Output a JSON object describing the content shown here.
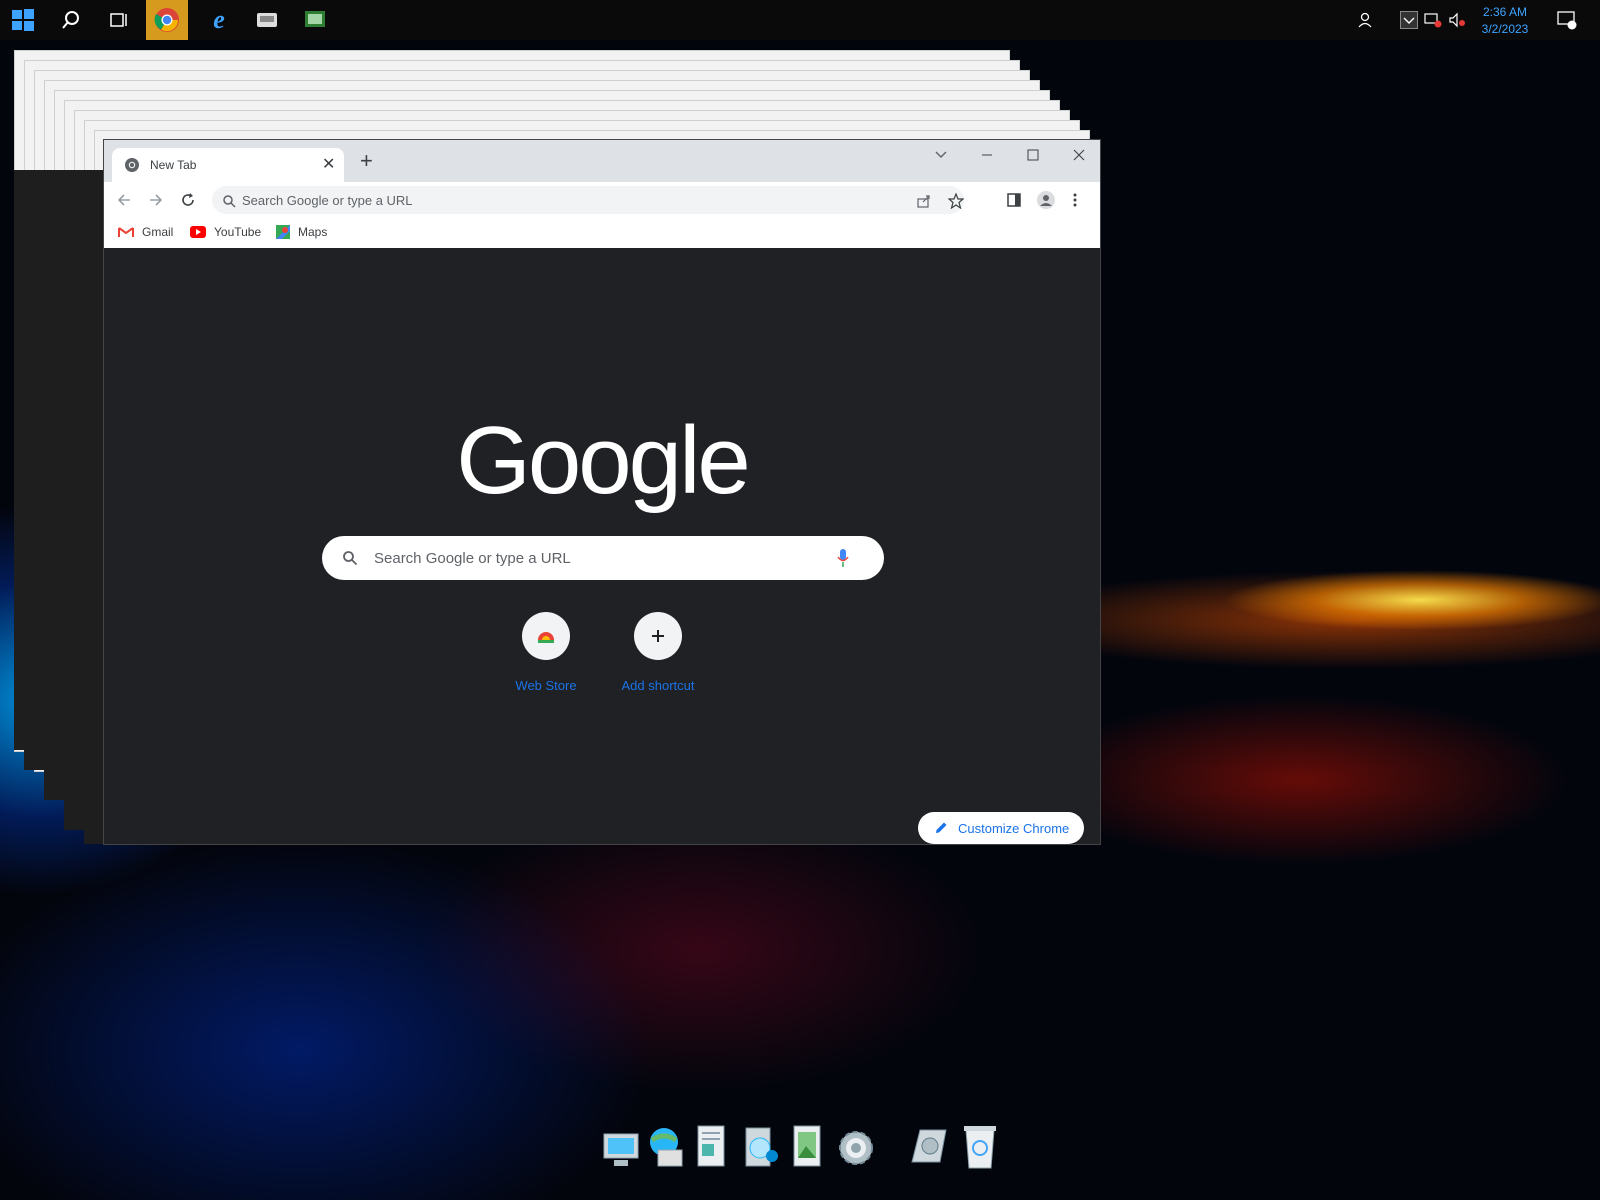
{
  "taskbar": {
    "items": [
      "start-icon",
      "search-icon",
      "task-view-icon",
      "chrome-icon",
      "internet-explorer-icon",
      "app-icon",
      "app-icon-2"
    ],
    "clock": {
      "time": "2:36 AM",
      "date": "3/2/2023"
    }
  },
  "browser": {
    "tab": {
      "title": "New Tab"
    },
    "omnibox": {
      "placeholder": "Search Google or type a URL"
    },
    "bookmarks": [
      {
        "label": "Gmail"
      },
      {
        "label": "YouTube"
      },
      {
        "label": "Maps"
      }
    ],
    "ntp": {
      "logo": "Google",
      "search_placeholder": "Search Google or type a URL",
      "shortcuts": [
        {
          "label": "Web Store"
        },
        {
          "label": "Add shortcut"
        }
      ],
      "customize_label": "Customize Chrome"
    }
  },
  "colors": {
    "accent": "#1a73e8",
    "clock": "#3ea3ff",
    "ntp_background": "#202124"
  }
}
